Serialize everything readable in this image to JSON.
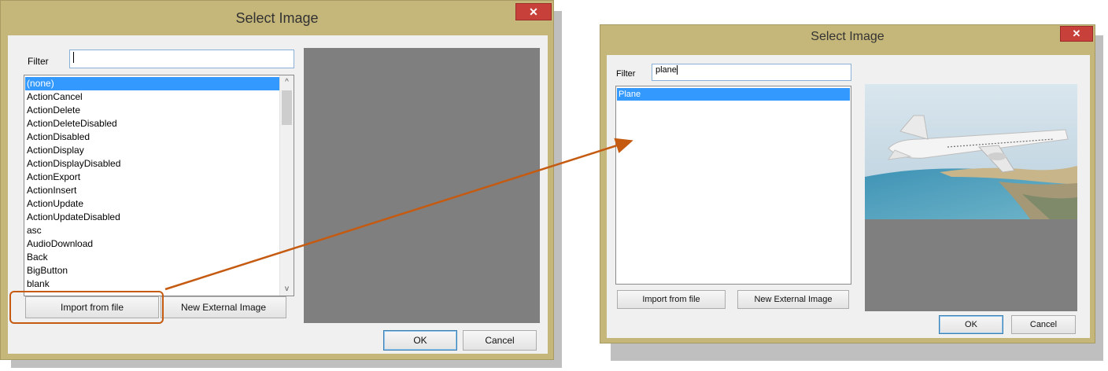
{
  "left_dialog": {
    "title": "Select Image",
    "close_glyph": "✕",
    "filter_label": "Filter",
    "filter_value": "",
    "items": [
      "(none)",
      "ActionCancel",
      "ActionDelete",
      "ActionDeleteDisabled",
      "ActionDisabled",
      "ActionDisplay",
      "ActionDisplayDisabled",
      "ActionExport",
      "ActionInsert",
      "ActionUpdate",
      "ActionUpdateDisabled",
      "asc",
      "AudioDownload",
      "Back",
      "BigButton",
      "blank"
    ],
    "selected_item": "(none)",
    "import_label": "Import from file",
    "new_external_label": "New External Image",
    "ok_label": "OK",
    "cancel_label": "Cancel",
    "scroll_up_glyph": "^",
    "scroll_down_glyph": "v"
  },
  "right_dialog": {
    "title": "Select Image",
    "close_glyph": "✕",
    "filter_label": "Filter",
    "filter_value": "plane",
    "items": [
      "Plane"
    ],
    "selected_item": "Plane",
    "import_label": "Import from file",
    "new_external_label": "New External Image",
    "ok_label": "OK",
    "cancel_label": "Cancel"
  },
  "colors": {
    "title_bar": "#c5b67a",
    "selection": "#3399ff",
    "close_button": "#c7403a",
    "annotation": "#c55a11",
    "preview_empty": "#7f7f7f"
  }
}
